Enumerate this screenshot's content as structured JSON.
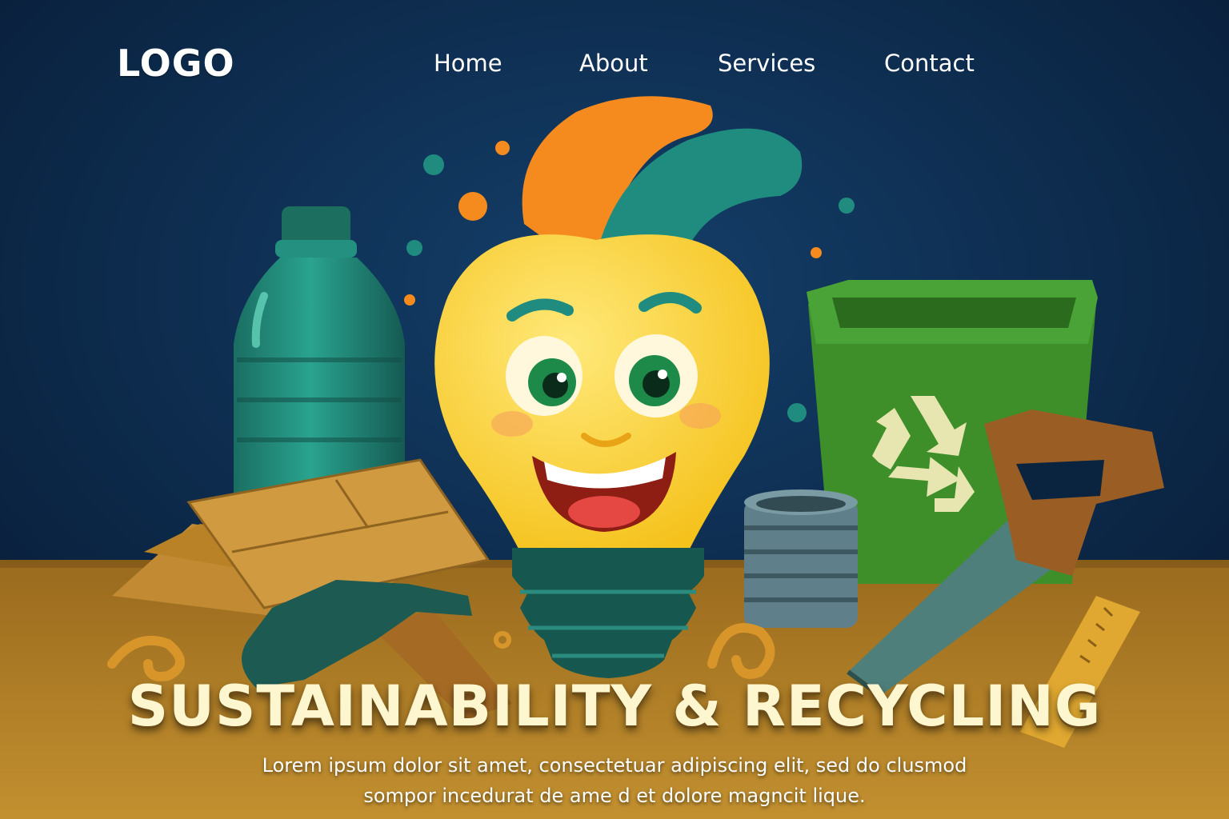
{
  "header": {
    "logo": "LOGO",
    "nav": [
      {
        "label": "Home"
      },
      {
        "label": "About"
      },
      {
        "label": "Services"
      },
      {
        "label": "Contact"
      }
    ]
  },
  "hero": {
    "title": "SUSTAINABILITY & RECYCLING",
    "subtitle_lines": [
      "Lorem ipsum dolor sit amet, consectetuar adipiscing elit, sed do clusmod",
      "sompor incedurat de ame d et dolore magncit lique."
    ],
    "illustration": {
      "icons": [
        "lightbulb-mascot",
        "plastic-bottle",
        "recycle-bin-icon",
        "hand-saw",
        "hammer",
        "tin-can",
        "cardboard",
        "ruler",
        "wood-shavings"
      ]
    }
  },
  "colors": {
    "background": "#0a2440",
    "table": "#b07a25",
    "bulb": "#ffd23a",
    "teal": "#1f8c7f",
    "orange": "#f58a1e",
    "bin_green": "#3e8f2a",
    "title": "#fdf6cf"
  }
}
